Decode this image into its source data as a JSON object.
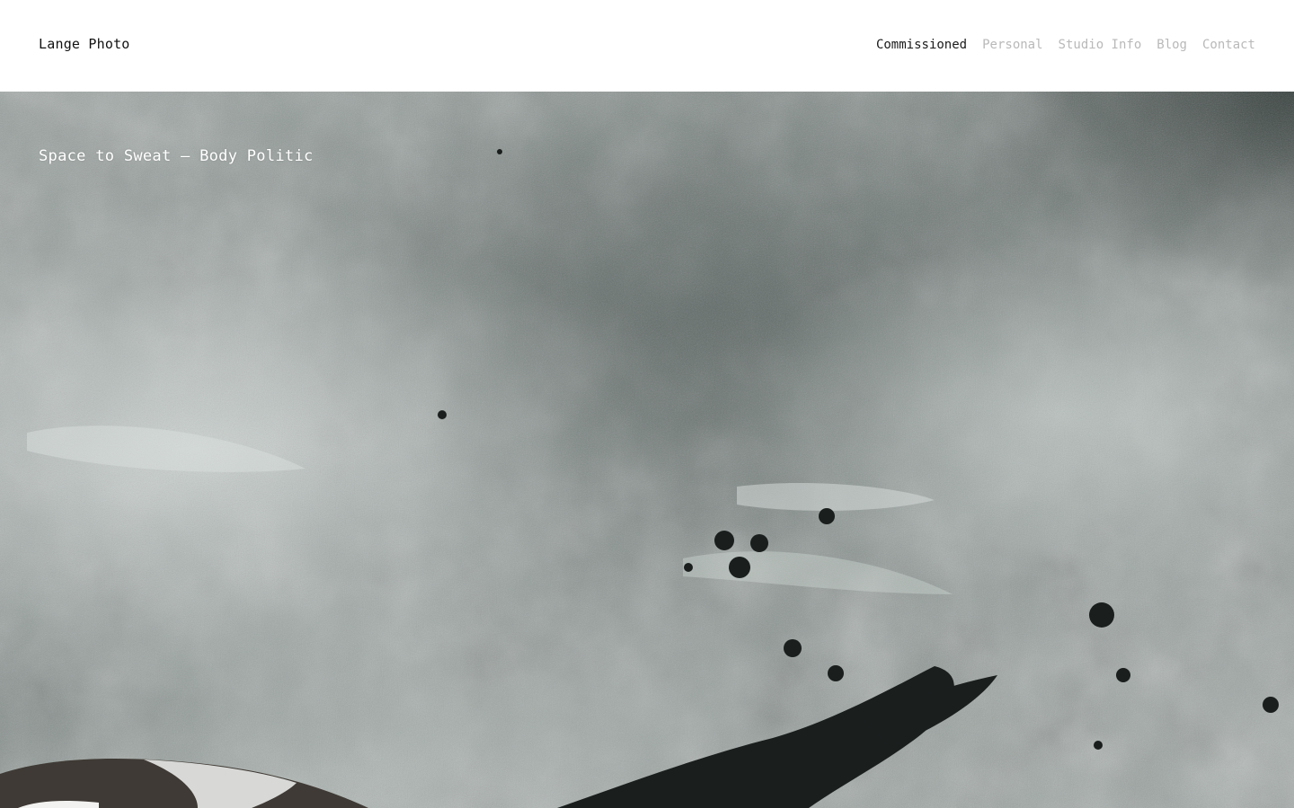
{
  "site": {
    "title": "Lange Photo"
  },
  "nav": {
    "items": [
      {
        "label": "Commissioned",
        "active": true
      },
      {
        "label": "Personal",
        "active": false
      },
      {
        "label": "Studio Info",
        "active": false
      },
      {
        "label": "Blog",
        "active": false
      },
      {
        "label": "Contact",
        "active": false
      }
    ]
  },
  "hero": {
    "caption": "Space to Sweat — Body Politic",
    "caption_color": "#ffffff"
  },
  "colors": {
    "nav_active": "#1a1a1a",
    "nav_inactive": "#b9b9b9",
    "background": "#ffffff"
  }
}
